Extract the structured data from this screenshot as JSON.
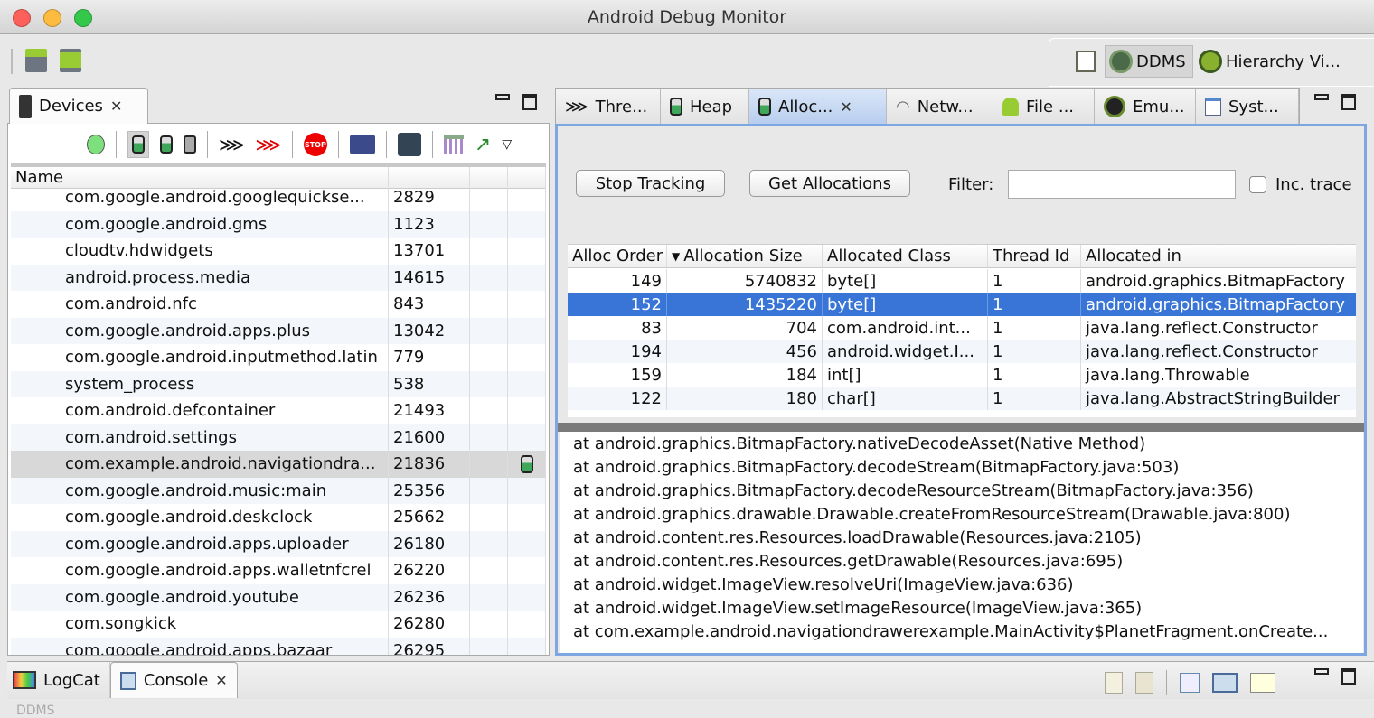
{
  "window": {
    "title": "Android Debug Monitor"
  },
  "perspectives": {
    "ddms": "DDMS",
    "hierarchy": "Hierarchy Vi..."
  },
  "devices_panel": {
    "tab": "Devices",
    "columns": [
      "Name",
      "",
      "",
      ""
    ],
    "rows": [
      {
        "name": "com.google.android.googlequickse...",
        "pid": "2829"
      },
      {
        "name": "com.google.android.gms",
        "pid": "1123"
      },
      {
        "name": "cloudtv.hdwidgets",
        "pid": "13701"
      },
      {
        "name": "android.process.media",
        "pid": "14615"
      },
      {
        "name": "com.android.nfc",
        "pid": "843"
      },
      {
        "name": "com.google.android.apps.plus",
        "pid": "13042"
      },
      {
        "name": "com.google.android.inputmethod.latin",
        "pid": "779"
      },
      {
        "name": "system_process",
        "pid": "538"
      },
      {
        "name": "com.android.defcontainer",
        "pid": "21493"
      },
      {
        "name": "com.android.settings",
        "pid": "21600"
      },
      {
        "name": "com.example.android.navigationdra...",
        "pid": "21836",
        "selected": true,
        "heap_icon": "heap-can-icon"
      },
      {
        "name": "com.google.android.music:main",
        "pid": "25356"
      },
      {
        "name": "com.google.android.deskclock",
        "pid": "25662"
      },
      {
        "name": "com.google.android.apps.uploader",
        "pid": "26180"
      },
      {
        "name": "com.google.android.apps.walletnfcrel",
        "pid": "26220"
      },
      {
        "name": "com.google.android.youtube",
        "pid": "26236"
      },
      {
        "name": "com.songkick",
        "pid": "26280"
      },
      {
        "name": "com.google.android.apps.bazaar",
        "pid": "26295"
      }
    ]
  },
  "right_tabs": [
    {
      "label": "Thre...",
      "icon": "threads-icon"
    },
    {
      "label": "Heap",
      "icon": "heap-icon"
    },
    {
      "label": "Alloc...",
      "icon": "allocation-icon",
      "active": true
    },
    {
      "label": "Netw...",
      "icon": "network-icon"
    },
    {
      "label": "File ...",
      "icon": "android-icon"
    },
    {
      "label": "Emu...",
      "icon": "emulator-icon"
    },
    {
      "label": "Syst...",
      "icon": "window-icon"
    }
  ],
  "alloc": {
    "stop_tracking": "Stop Tracking",
    "get_allocations": "Get Allocations",
    "filter_label": "Filter:",
    "filter_value": "",
    "inc_trace": "Inc. trace",
    "inc_trace_checked": false,
    "columns": [
      "Alloc Order",
      "Allocation Size",
      "Allocated Class",
      "Thread Id",
      "Allocated in"
    ],
    "sort_column": "Allocation Size",
    "sort_direction": "descending",
    "rows": [
      [
        "149",
        "5740832",
        "byte[]",
        "1",
        "android.graphics.BitmapFactory"
      ],
      [
        "152",
        "1435220",
        "byte[]",
        "1",
        "android.graphics.BitmapFactory"
      ],
      [
        "83",
        "704",
        "com.android.int...",
        "1",
        "java.lang.reflect.Constructor"
      ],
      [
        "194",
        "456",
        "android.widget.I...",
        "1",
        "java.lang.reflect.Constructor"
      ],
      [
        "159",
        "184",
        "int[]",
        "1",
        "java.lang.Throwable"
      ],
      [
        "122",
        "180",
        "char[]",
        "1",
        "java.lang.AbstractStringBuilder"
      ]
    ],
    "selected_row": 1,
    "trace": [
      "at android.graphics.BitmapFactory.nativeDecodeAsset(Native Method)",
      "at android.graphics.BitmapFactory.decodeStream(BitmapFactory.java:503)",
      "at android.graphics.BitmapFactory.decodeResourceStream(BitmapFactory.java:356)",
      "at android.graphics.drawable.Drawable.createFromResourceStream(Drawable.java:800)",
      "at android.content.res.Resources.loadDrawable(Resources.java:2105)",
      "at android.content.res.Resources.getDrawable(Resources.java:695)",
      "at android.widget.ImageView.resolveUri(ImageView.java:636)",
      "at android.widget.ImageView.setImageResource(ImageView.java:365)",
      "at com.example.android.navigationdrawerexample.MainActivity$PlanetFragment.onCreate..."
    ]
  },
  "bottom_tabs": [
    {
      "label": "LogCat",
      "icon": "logcat-icon"
    },
    {
      "label": "Console",
      "icon": "console-icon",
      "active": true
    }
  ],
  "status": "DDMS",
  "colors": {
    "selection": "#3875d7",
    "active_tab": "#b7cdee",
    "panel_border": "#7ea6e0"
  }
}
